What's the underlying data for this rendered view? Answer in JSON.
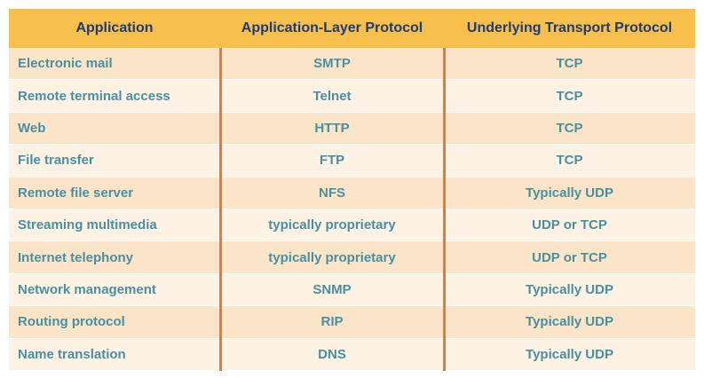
{
  "table": {
    "headers": {
      "application": "Application",
      "app_layer_protocol": "Application-Layer Protocol",
      "transport_protocol": "Underlying Transport Protocol"
    },
    "rows": [
      {
        "application": "Electronic mail",
        "protocol": "SMTP",
        "transport": "TCP"
      },
      {
        "application": "Remote terminal access",
        "protocol": "Telnet",
        "transport": "TCP"
      },
      {
        "application": "Web",
        "protocol": "HTTP",
        "transport": "TCP"
      },
      {
        "application": "File transfer",
        "protocol": "FTP",
        "transport": "TCP"
      },
      {
        "application": "Remote file server",
        "protocol": "NFS",
        "transport": "Typically UDP"
      },
      {
        "application": "Streaming multimedia",
        "protocol": "typically proprietary",
        "transport": "UDP or TCP"
      },
      {
        "application": "Internet telephony",
        "protocol": "typically proprietary",
        "transport": "UDP or TCP"
      },
      {
        "application": "Network management",
        "protocol": "SNMP",
        "transport": "Typically UDP"
      },
      {
        "application": "Routing protocol",
        "protocol": "RIP",
        "transport": "Typically UDP"
      },
      {
        "application": "Name translation",
        "protocol": "DNS",
        "transport": "Typically UDP"
      }
    ]
  },
  "colors": {
    "header_bg": "#f6c04a",
    "header_text": "#213a77",
    "row_odd_bg": "#fbe5c8",
    "row_even_bg": "#fdf2e4",
    "cell_text": "#4a8f9f",
    "divider": "#e8783a"
  }
}
